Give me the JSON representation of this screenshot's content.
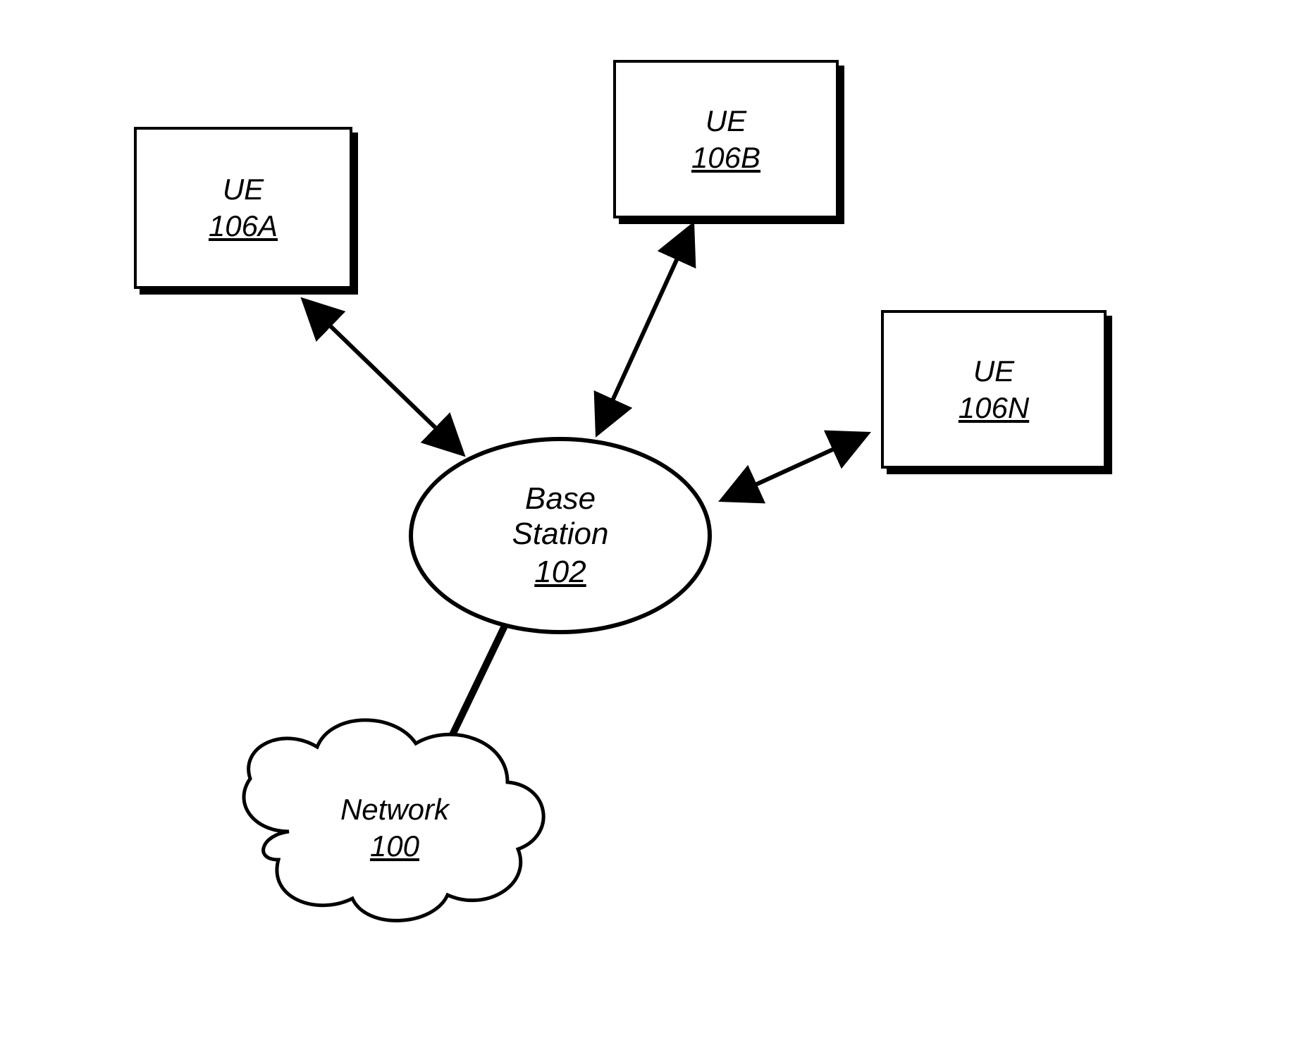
{
  "nodes": {
    "ue_a": {
      "label": "UE",
      "ref": "106A"
    },
    "ue_b": {
      "label": "UE",
      "ref": "106B"
    },
    "ue_n": {
      "label": "UE",
      "ref": "106N"
    },
    "base_station": {
      "line1": "Base",
      "line2": "Station",
      "ref": "102"
    },
    "network": {
      "label": "Network",
      "ref": "100"
    }
  }
}
